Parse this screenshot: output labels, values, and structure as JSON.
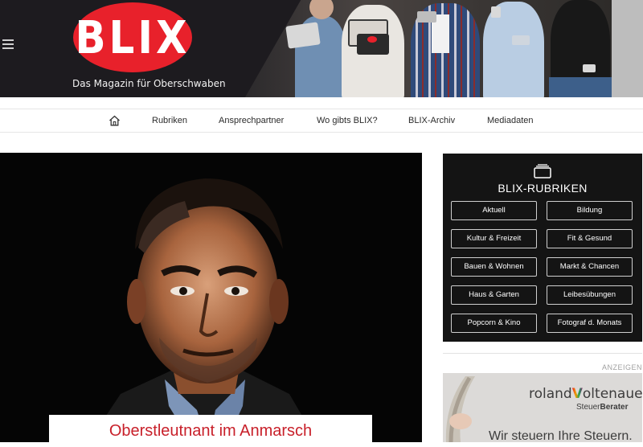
{
  "header": {
    "logo_text": "BLIX",
    "tagline": "Das Magazin für Oberschwaben"
  },
  "nav": {
    "home_icon": "home-icon",
    "items": [
      {
        "label": "Rubriken"
      },
      {
        "label": "Ansprechpartner"
      },
      {
        "label": "Wo gibts BLIX?"
      },
      {
        "label": "BLIX-Archiv"
      },
      {
        "label": "Mediadaten"
      }
    ]
  },
  "hero": {
    "caption": "Oberstleutnant im Anmarsch"
  },
  "sidebar": {
    "icon": "stack-icon",
    "title": "BLIX-RUBRIKEN",
    "buttons": [
      {
        "label": "Aktuell"
      },
      {
        "label": "Bildung"
      },
      {
        "label": "Kultur & Freizeit"
      },
      {
        "label": "Fit & Gesund"
      },
      {
        "label": "Bauen & Wohnen"
      },
      {
        "label": "Markt & Chancen"
      },
      {
        "label": "Haus & Garten"
      },
      {
        "label": "Leibesübungen"
      },
      {
        "label": "Popcorn & Kino"
      },
      {
        "label": "Fotograf d. Monats"
      }
    ],
    "ads_label": "ANZEIGEN"
  },
  "ad": {
    "brand_prefix": "roland",
    "brand_v": "V",
    "brand_suffix": "oltenauer",
    "sub_prefix": "Steuer",
    "sub_bold": "Berater",
    "slogan": "Wir steuern Ihre Steuern."
  },
  "colors": {
    "brand_red": "#e8212b",
    "caption_red": "#c8202a",
    "header_bg": "#1d1b1f",
    "sidebar_bg": "#141414"
  }
}
